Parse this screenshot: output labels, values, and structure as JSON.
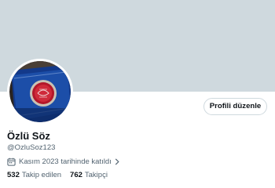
{
  "profile": {
    "name": "Özlü Söz",
    "handle": "@OzluSoz123",
    "edit_profile_label": "Profili düzenle",
    "joined_text": "Kasım 2023 tarihinde katıldı",
    "following": {
      "count": "532",
      "label": "Takip edilen"
    },
    "followers": {
      "count": "762",
      "label": "Takipçi"
    }
  },
  "icons": {
    "joined": "calendar-icon",
    "joined_more": "chevron-right-icon",
    "avatar": "book-cover-image"
  },
  "colors": {
    "banner": "#cfd9de",
    "text_primary": "#0f1419",
    "text_secondary": "#536471",
    "button_border": "#cfd9de"
  }
}
